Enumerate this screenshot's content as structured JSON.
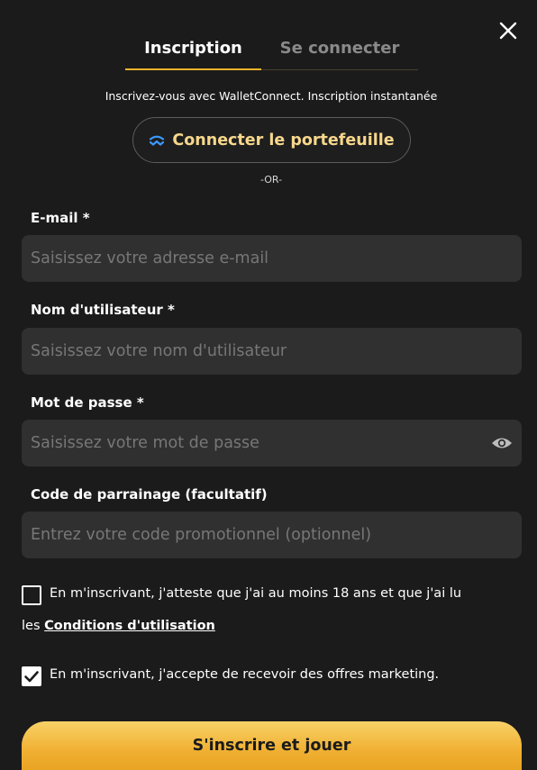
{
  "tabs": {
    "signup": "Inscription",
    "login": "Se connecter"
  },
  "subtitle": "Inscrivez-vous avec WalletConnect. Inscription instantanée",
  "wallet_button": {
    "label": "Connecter le portefeuille",
    "icon": "walletconnect-icon",
    "icon_color": "#3b99fc",
    "text_color": "#f7d78c"
  },
  "or_text": "-OR-",
  "fields": {
    "email": {
      "label": "E-mail *",
      "placeholder": "Saisissez votre adresse e-mail",
      "value": ""
    },
    "username": {
      "label": "Nom d'utilisateur *",
      "placeholder": "Saisissez votre nom d'utilisateur",
      "value": ""
    },
    "password": {
      "label": "Mot de passe *",
      "placeholder": "Saisissez votre mot de passe",
      "value": "",
      "toggle_icon": "eye-icon"
    },
    "referral": {
      "label": "Code de parrainage (facultatif)",
      "placeholder": "Entrez votre code promotionnel (optionnel)",
      "value": ""
    }
  },
  "checkboxes": {
    "age": {
      "checked": false,
      "text_line1": "En m'inscrivant, j'atteste que j'ai au moins 18 ans et que j'ai lu",
      "text_prefix": "les ",
      "link_text": "Conditions d'utilisation"
    },
    "marketing": {
      "checked": true,
      "text": "En m'inscrivant, j'accepte de recevoir des offres marketing."
    }
  },
  "submit_button": {
    "label": "S'inscrire et jouer"
  },
  "colors": {
    "background": "#1b1b1b",
    "input_bg": "#303030",
    "accent": "#f0b429",
    "inactive_tab": "#8a8a8a"
  }
}
